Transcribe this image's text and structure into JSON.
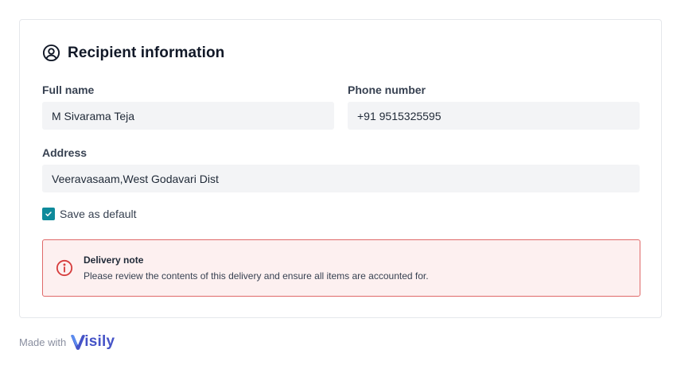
{
  "card": {
    "title": "Recipient information",
    "title_icon": "user-circle-icon"
  },
  "form": {
    "full_name": {
      "label": "Full name",
      "value": "M Sivarama Teja"
    },
    "phone_number": {
      "label": "Phone number",
      "value": "+91 9515325595"
    },
    "address": {
      "label": "Address",
      "value": "Veeravasaam,West Godavari Dist"
    },
    "save_default": {
      "label": "Save as default",
      "checked": true
    }
  },
  "alert": {
    "icon": "info-circle-icon",
    "title": "Delivery note",
    "body": "Please review the contents of this delivery and ensure all items are accounted for."
  },
  "footer": {
    "made_with": "Made with",
    "brand": "isily",
    "brand_mark": "visily-v-logo"
  },
  "colors": {
    "accent": "#0e8a9b",
    "alert_border": "#e06969",
    "alert_bg": "#fdf0f0",
    "alert_icon": "#d63c3c",
    "input_bg": "#f3f4f6",
    "brand": "#4553c7"
  }
}
